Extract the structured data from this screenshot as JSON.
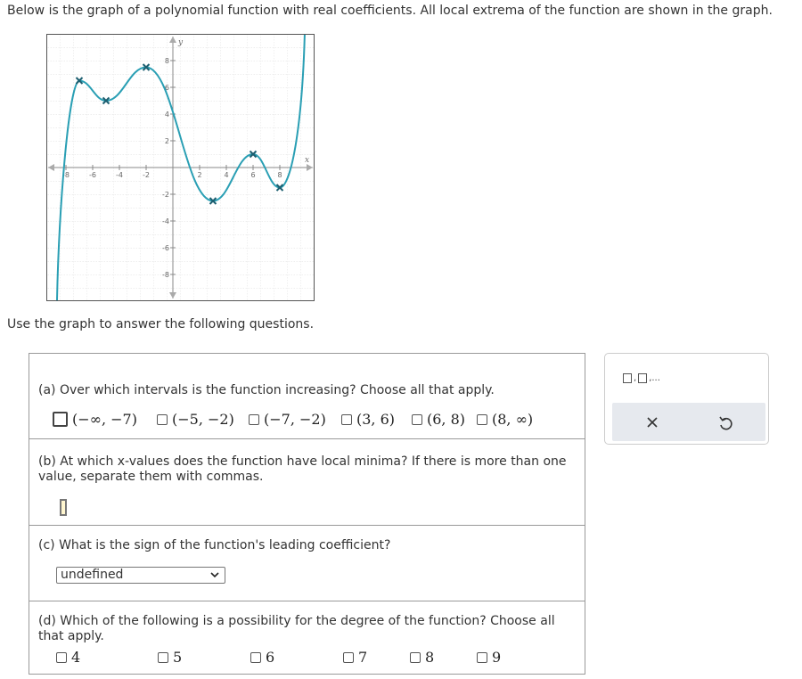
{
  "intro_text": "Below is the graph of a polynomial function with real coefficients. All local extrema of the function are shown in the graph.",
  "use_graph_text": "Use the graph to answer the following questions.",
  "graph": {
    "y_axis_label": "y",
    "x_axis_label": "x",
    "x_tick_labels": [
      "-8",
      "-6",
      "-4",
      "-2",
      "2",
      "4",
      "6",
      "8"
    ],
    "y_tick_labels": [
      "8",
      "6",
      "4",
      "2",
      "-2",
      "-4",
      "-6",
      "-8"
    ],
    "curve_color": "#2a9fb4",
    "extrema": [
      {
        "x": -7,
        "y": 6.5,
        "type": "max"
      },
      {
        "x": -5,
        "y": 5,
        "type": "min"
      },
      {
        "x": -2,
        "y": 7.5,
        "type": "max"
      },
      {
        "x": 3,
        "y": -2.5,
        "type": "min"
      },
      {
        "x": 6,
        "y": 1,
        "type": "max"
      },
      {
        "x": 8,
        "y": -1.5,
        "type": "min"
      }
    ]
  },
  "question_a": {
    "prompt": "(a) Over which intervals is the function increasing? Choose all that apply.",
    "options": [
      "(−∞, −7)",
      "(−5, −2)",
      "(−7, −2)",
      "(3, 6)",
      "(6, 8)",
      "(8, ∞)"
    ]
  },
  "question_b": {
    "prompt_line1": "(b) At which x-values does the function have local minima? If there is more than one",
    "prompt_line2": "value, separate them with commas.",
    "answer_value": ""
  },
  "question_c": {
    "prompt": "(c) What is the sign of the function's leading coefficient?",
    "selected": "undefined"
  },
  "question_d": {
    "prompt_line1": "(d) Which of the following is a possibility for the degree of the function? Choose all",
    "prompt_line2": "that apply.",
    "options": [
      "4",
      "5",
      "6",
      "7",
      "8",
      "9"
    ]
  },
  "toolbar": {
    "template_icon": "ordered-pair-template-icon",
    "clear_icon": "clear-icon",
    "undo_icon": "undo-icon"
  }
}
